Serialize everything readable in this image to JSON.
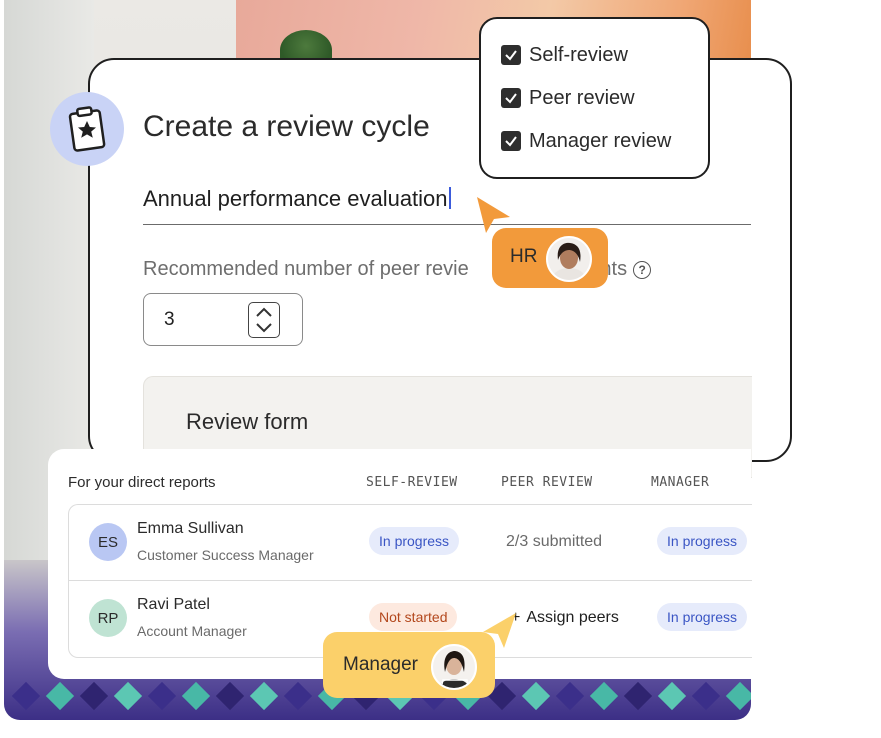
{
  "card": {
    "title": "Create a review cycle",
    "cycle_name_value": "Annual performance evaluation",
    "peer_label_before": "Recommended number of peer revie",
    "peer_label_after": "cipants",
    "peer_count": "3",
    "review_form_label": "Review form"
  },
  "checklist": {
    "items": [
      {
        "label": "Self-review",
        "checked": true
      },
      {
        "label": "Peer review",
        "checked": true
      },
      {
        "label": "Manager review",
        "checked": true
      }
    ]
  },
  "cursors": {
    "hr_label": "HR",
    "manager_label": "Manager",
    "hr_color": "#f29a3b",
    "manager_color": "#fbd06a"
  },
  "table": {
    "title": "For your direct reports",
    "columns": [
      "SELF-REVIEW",
      "PEER REVIEW",
      "MANAGER"
    ],
    "rows": [
      {
        "initials": "ES",
        "name": "Emma Sullivan",
        "role": "Customer Success Manager",
        "self_review": "In progress",
        "peer_review": "2/3 submitted",
        "manager": "In progress",
        "avatar_color": "#b9c7f3"
      },
      {
        "initials": "RP",
        "name": "Ravi Patel",
        "role": "Account Manager",
        "self_review": "Not started",
        "peer_review_action": "Assign peers",
        "manager": "In progress",
        "avatar_color": "#bfe3d3"
      }
    ]
  },
  "icons": {
    "badge": "clipboard-star-icon",
    "help": "question-circle-icon",
    "stepper": "chevron-up-down-icon",
    "check": "checkbox-checked-icon",
    "add": "plus-icon"
  }
}
